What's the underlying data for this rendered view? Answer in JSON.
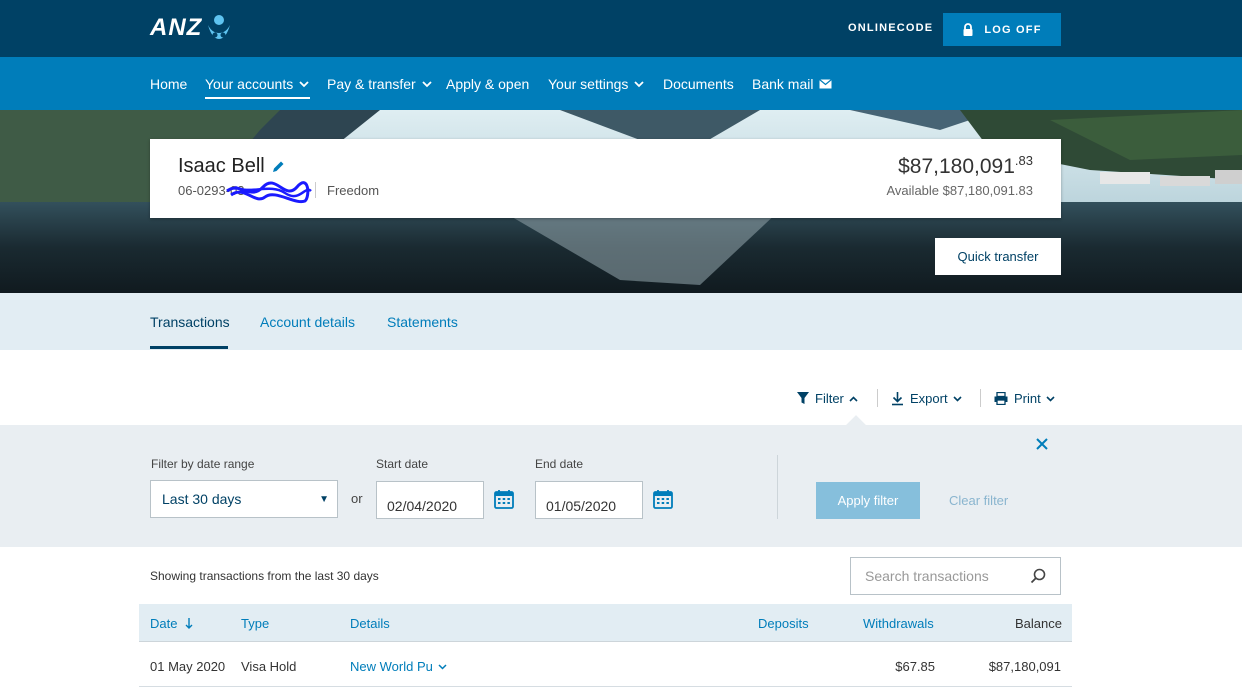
{
  "brand": {
    "name": "ANZ"
  },
  "header": {
    "onlinecode_label": "ONLINECODE",
    "logoff_label": "LOG OFF"
  },
  "nav": {
    "items": [
      {
        "label": "Home"
      },
      {
        "label": "Your accounts",
        "active": true
      },
      {
        "label": "Pay & transfer"
      },
      {
        "label": "Apply & open"
      },
      {
        "label": "Your settings"
      },
      {
        "label": "Documents"
      },
      {
        "label": "Bank mail"
      }
    ]
  },
  "account": {
    "name": "Isaac Bell",
    "number": "06-0293-03",
    "type": "Freedom",
    "balance_dollars": "$87,180,091",
    "balance_cents": ".83",
    "available": "Available $87,180,091.83"
  },
  "quick_transfer_label": "Quick transfer",
  "tabs": [
    {
      "label": "Transactions",
      "active": true
    },
    {
      "label": "Account details"
    },
    {
      "label": "Statements"
    }
  ],
  "toolbar": {
    "filter_label": "Filter",
    "export_label": "Export",
    "print_label": "Print"
  },
  "filter": {
    "range_label": "Filter by date range",
    "range_value": "Last 30 days",
    "or_label": "or",
    "start_label": "Start date",
    "start_value": "02/04/2020",
    "end_label": "End date",
    "end_value": "01/05/2020",
    "apply_label": "Apply filter",
    "clear_label": "Clear filter"
  },
  "transactions": {
    "showing_text": "Showing transactions from the last 30 days",
    "search_placeholder": "Search transactions",
    "columns": {
      "date": "Date",
      "type": "Type",
      "details": "Details",
      "deposits": "Deposits",
      "withdrawals": "Withdrawals",
      "balance": "Balance"
    },
    "rows": [
      {
        "date": "01 May 2020",
        "type": "Visa Hold",
        "details": "New World Pu",
        "deposits": "",
        "withdrawals": "$67.85",
        "balance": "$87,180,091"
      }
    ]
  },
  "colors": {
    "brand_dark": "#004165",
    "brand_blue": "#007dba",
    "panel_bg": "#e9eef2",
    "tab_bg": "#e2edf3"
  },
  "icons": [
    "anz-logo-icon",
    "lock-icon",
    "chevron-down-icon",
    "mail-icon",
    "pencil-icon",
    "filter-icon",
    "chevron-up-icon",
    "download-icon",
    "print-icon",
    "close-icon",
    "calendar-icon",
    "search-icon",
    "sort-down-arrow-icon"
  ]
}
